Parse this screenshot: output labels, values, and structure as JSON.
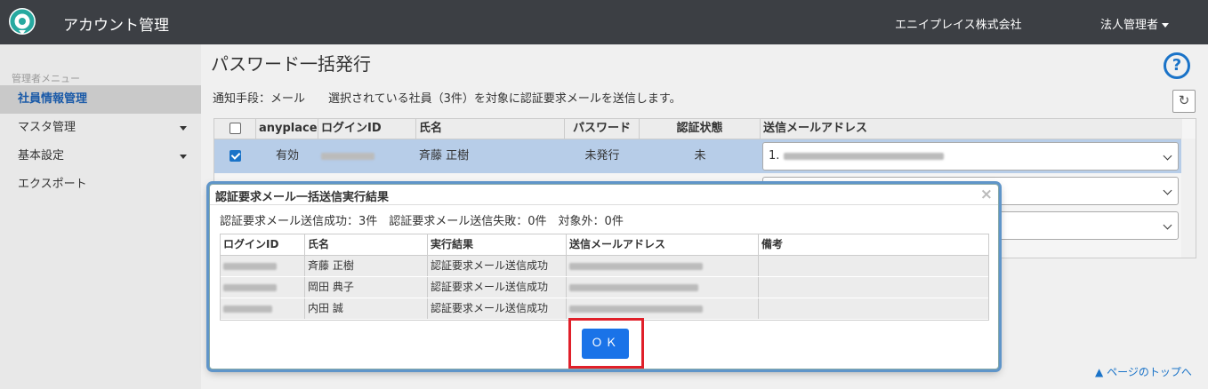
{
  "header": {
    "app_title": "アカウント管理",
    "company": "エニイプレイス株式会社",
    "user_menu": "法人管理者",
    "brand_color": "#3c3f44",
    "logo_color": "#27a9a0"
  },
  "sidebar": {
    "heading": "管理者メニュー",
    "items": [
      {
        "label": "社員情報管理",
        "active": true
      },
      {
        "label": "マスタ管理",
        "has_submenu": true
      },
      {
        "label": "基本設定",
        "has_submenu": true
      },
      {
        "label": "エクスポート"
      }
    ]
  },
  "main": {
    "title": "パスワード一括発行",
    "help_icon": "help-circle-icon",
    "notify_label": "通知手段：",
    "notify_value": "メール",
    "notify_message": "選択されている社員（3件）を対象に認証要求メールを送信します。",
    "refresh_icon": "refresh-icon"
  },
  "employee_table": {
    "headers": [
      "anyplace",
      "ログインID",
      "氏名",
      "パスワード",
      "認証状態",
      "送信メールアドレス"
    ],
    "rows": [
      {
        "checked": true,
        "anyplace": "有効",
        "name": "斉藤 正樹",
        "password": "未発行",
        "status": "未",
        "email": "1."
      }
    ]
  },
  "modal": {
    "title": "認証要求メール一括送信実行結果",
    "summary": "認証要求メール送信成功：3件　認証要求メール送信失敗：0件　対象外：0件",
    "headers": [
      "ログインID",
      "氏名",
      "実行結果",
      "送信メールアドレス",
      "備考"
    ],
    "rows": [
      {
        "name": "斉藤 正樹",
        "result": "認証要求メール送信成功"
      },
      {
        "name": "岡田 典子",
        "result": "認証要求メール送信成功"
      },
      {
        "name": "内田 誠",
        "result": "認証要求メール送信成功"
      }
    ],
    "ok_label": "ＯＫ"
  },
  "footer": {
    "page_top": "ページのトップへ"
  }
}
